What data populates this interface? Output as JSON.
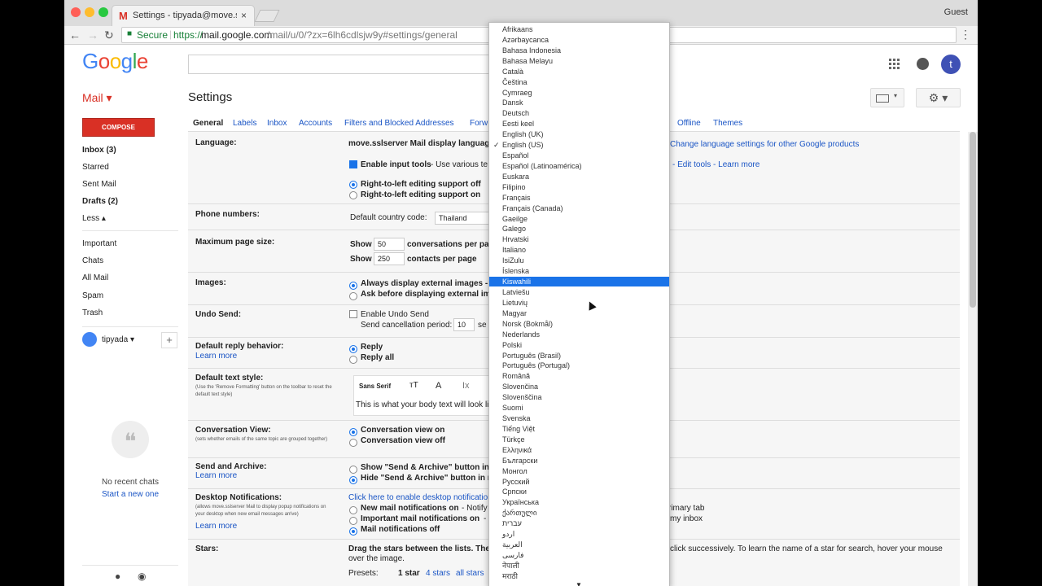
{
  "browser": {
    "tab_title": "Settings - tipyada@move.ssls",
    "tab_close": "×",
    "guest_label": "Guest",
    "secure_label": "Secure",
    "url_scheme": "https://",
    "url_host": "mail.google.com",
    "url_path": "/mail/u/0/?zx=6lh6cdlsjw9y#settings/general",
    "back": "←",
    "forward": "→",
    "reload": "↻",
    "menu": "⋮"
  },
  "header": {
    "logo_letters": [
      "G",
      "o",
      "o",
      "g",
      "l",
      "e"
    ],
    "logo_colors": [
      "#4285f4",
      "#ea4335",
      "#fbbc05",
      "#4285f4",
      "#34a853",
      "#ea4335"
    ],
    "avatar_letter": "t",
    "mail_label": "Mail ▾",
    "page_title": "Settings",
    "gear": "⚙ ▾"
  },
  "nav": {
    "compose": "COMPOSE",
    "items": [
      {
        "label": "Inbox (3)",
        "bold": true
      },
      {
        "label": "Starred",
        "bold": false
      },
      {
        "label": "Sent Mail",
        "bold": false
      },
      {
        "label": "Drafts (2)",
        "bold": true
      },
      {
        "label": "Less ▴",
        "bold": false
      },
      {
        "label": "Important",
        "bold": false
      },
      {
        "label": "Chats",
        "bold": false
      },
      {
        "label": "All Mail",
        "bold": false
      },
      {
        "label": "Spam",
        "bold": false
      },
      {
        "label": "Trash",
        "bold": false
      }
    ],
    "username": "tipyada ▾",
    "plus": "+",
    "no_recent": "No recent chats",
    "start_new": "Start a new one"
  },
  "tabs": [
    {
      "label": "General",
      "active": true
    },
    {
      "label": "Labels",
      "active": false
    },
    {
      "label": "Inbox",
      "active": false
    },
    {
      "label": "Accounts",
      "active": false
    },
    {
      "label": "Filters and Blocked Addresses",
      "active": false
    },
    {
      "label": "Forw",
      "active": false
    },
    {
      "label": "Offline",
      "active": false
    },
    {
      "label": "Themes",
      "active": false
    }
  ],
  "settings": {
    "language_label": "Language:",
    "language_text": "move.sslserver Mail display language:",
    "change_lang_link": "Change language settings for other Google products",
    "input_tools": "Enable input tools",
    "input_tools_rest": " - Use various te",
    "edit_tools": "- Edit tools - Learn more",
    "rtl_off": "Right-to-left editing support off",
    "rtl_on": "Right-to-left editing support on",
    "phone_label": "Phone numbers:",
    "country_code": "Default country code:",
    "country_value": "Thailand",
    "page_size_label": "Maximum page size:",
    "show": "Show",
    "conv_value": "50",
    "conv_text": "conversations per pa",
    "contacts_value": "250",
    "contacts_text": "contacts per page",
    "images_label": "Images:",
    "images_always": "Always display external images - L",
    "images_ask": "Ask before displaying external ima",
    "undo_label": "Undo Send:",
    "undo_enable": "Enable Undo Send",
    "undo_period": "Send cancellation period:",
    "undo_value": "10",
    "undo_se": "se",
    "reply_label": "Default reply behavior:",
    "learn_more": "Learn more",
    "reply": "Reply",
    "reply_all": "Reply all",
    "text_style_label": "Default text style:",
    "text_style_sub": "(Use the 'Remove Formatting' button on the toolbar to reset the default text style)",
    "font_name": "Sans Serif",
    "editor_sample": "This is what your body text will look li",
    "conv_view_label": "Conversation View:",
    "conv_view_sub": "(sets whether emails of the same topic are grouped together)",
    "conv_on": "Conversation view on",
    "conv_off": "Conversation view off",
    "send_archive_label": "Send and Archive:",
    "send_archive_show": "Show \"Send & Archive\" button in r",
    "send_archive_hide": "Hide \"Send & Archive\" button in r",
    "desktop_label": "Desktop Notifications:",
    "desktop_sub": "(allows move.sslserver Mail to display popup notifications on your desktop when new email messages arrive)",
    "desktop_link": "Click here to enable desktop notification",
    "new_mail_on": "New mail notifications on",
    "new_mail_rest": " - Notify n",
    "primary_tab": "rimary tab",
    "important_on": "Important mail notifications on",
    "important_rest": " - N",
    "my_inbox": "my inbox",
    "notif_off": "Mail notifications off",
    "stars_label": "Stars:",
    "stars_text": "Drag the stars between the lists.  The",
    "stars_text2": "over the image.",
    "stars_right": "click successively. To learn the name of a star for search, hover your mouse",
    "presets": "Presets:",
    "one_star": "1 star",
    "four_stars": "4 stars",
    "all_stars": "all stars"
  },
  "dropdown": {
    "selected": "English (US)",
    "highlighted": "Kiswahili",
    "checkmark": "✓",
    "languages": [
      "Afrikaans",
      "Azərbaycanca",
      "Bahasa Indonesia",
      "Bahasa Melayu",
      "Català",
      "Čeština",
      "Cymraeg",
      "Dansk",
      "Deutsch",
      "Eesti keel",
      "English (UK)",
      "English (US)",
      "Español",
      "Español (Latinoamérica)",
      "Euskara",
      "Filipino",
      "Français",
      "Français (Canada)",
      "Gaeilge",
      "Galego",
      "Hrvatski",
      "Italiano",
      "IsiZulu",
      "Íslenska",
      "Kiswahili",
      "Latviešu",
      "Lietuvių",
      "Magyar",
      "Norsk (Bokmål)",
      "Nederlands",
      "Polski",
      "Português (Brasil)",
      "Português (Portugal)",
      "Română",
      "Slovenčina",
      "Slovenščina",
      "Suomi",
      "Svenska",
      "Tiếng Việt",
      "Türkçe",
      "Ελληνικά",
      "Български",
      "Монгол",
      "Русский",
      "Српски",
      "Українська",
      "ქართული",
      "עברית",
      "اردو",
      "العربية",
      "فارسی",
      "नेपाली",
      "मराठी"
    ]
  }
}
